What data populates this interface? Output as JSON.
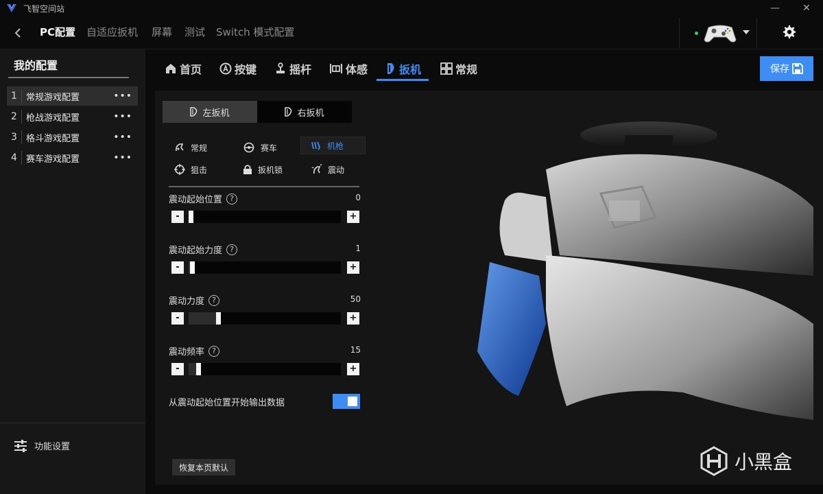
{
  "titlebar": {
    "title": "飞智空间站",
    "minimize": "—",
    "close": "✕"
  },
  "topnav": {
    "items": [
      "PC配置",
      "自适应扳机",
      "屏幕",
      "测试",
      "Switch 模式配置"
    ],
    "active_index": 0
  },
  "device": {
    "status_color": "#2ecc71"
  },
  "sidebar": {
    "title": "我的配置",
    "configs": [
      {
        "num": "1",
        "name": "常规游戏配置"
      },
      {
        "num": "2",
        "name": "枪战游戏配置"
      },
      {
        "num": "3",
        "name": "格斗游戏配置"
      },
      {
        "num": "4",
        "name": "赛车游戏配置"
      }
    ],
    "active_index": 0,
    "more": "•••",
    "function_settings": "功能设置"
  },
  "tabs": {
    "items": [
      {
        "label": "首页",
        "icon": "home-icon"
      },
      {
        "label": "按键",
        "icon": "button-a-icon"
      },
      {
        "label": "摇杆",
        "icon": "joystick-icon"
      },
      {
        "label": "体感",
        "icon": "motion-icon"
      },
      {
        "label": "扳机",
        "icon": "trigger-icon"
      },
      {
        "label": "常规",
        "icon": "grid-icon"
      }
    ],
    "active_index": 4,
    "save": "保存"
  },
  "trigger_panel": {
    "left_trigger": "左扳机",
    "right_trigger": "右扳机",
    "active_trigger": "left",
    "modes": [
      "常规",
      "赛车",
      "机枪",
      "狙击",
      "扳机锁",
      "震动"
    ],
    "active_mode_index": 2,
    "sliders": [
      {
        "label": "震动起始位置",
        "value": "0",
        "level_pct": 0
      },
      {
        "label": "震动起始力度",
        "value": "1",
        "level_pct": 1
      },
      {
        "label": "震动力度",
        "value": "50",
        "level_pct": 18
      },
      {
        "label": "震动频率",
        "value": "15",
        "level_pct": 5
      }
    ],
    "minus": "-",
    "plus": "+",
    "help": "?",
    "output_toggle": {
      "label": "从震动起始位置开始输出数据",
      "on": true
    },
    "restore": "恢复本页默认"
  },
  "watermark": {
    "text": "小黑盒"
  },
  "colors": {
    "accent": "#3d8df5",
    "panel": "#151515",
    "sidebar": "#171717"
  }
}
